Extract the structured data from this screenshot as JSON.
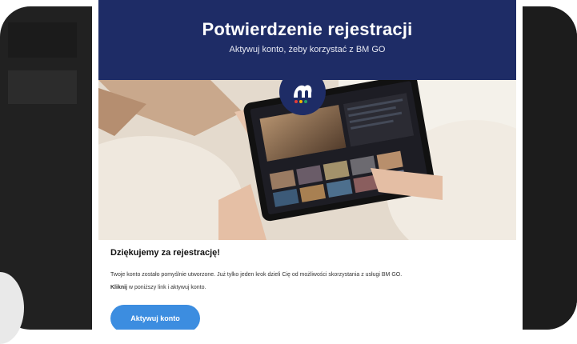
{
  "email": {
    "header": {
      "title": "Potwierdzenie rejestracji",
      "subtitle": "Aktywuj konto, żeby korzystać z BM GO"
    },
    "logo": {
      "icon": "bm-go-logo"
    },
    "content": {
      "heading": "Dziękujemy za rejestrację!",
      "paragraph_1": "Twoje konto zostało pomyślnie utworzone. Już tylko jeden krok dzieli Cię od możliwości skorzystania z usługi BM GO.",
      "paragraph_2_bold": "Kliknij",
      "paragraph_2_rest": " w poniższy link i aktywuj konto."
    },
    "cta": {
      "label": "Aktywuj konto"
    }
  },
  "colors": {
    "header_bg": "#1e2c66",
    "cta_bg": "#3c8de0",
    "device_bg": "#212121"
  }
}
